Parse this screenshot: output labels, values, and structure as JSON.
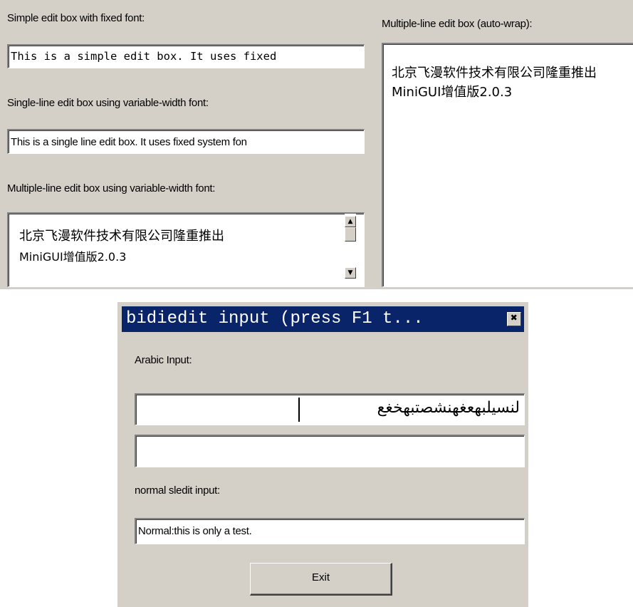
{
  "top_panel": {
    "simple_label": "Simple edit box with fixed font:",
    "simple_value": "This is a simple edit box. It uses fixed",
    "single_label": "Single-line edit box using variable-width font:",
    "single_value": "This is a single line edit box. It uses fixed system fon",
    "multi_label": "Multiple-line edit box using variable-width font:",
    "multi_value_line1": "北京飞漫软件技术有限公司隆重推出",
    "multi_value_line2": "MiniGUI增值版2.0.3",
    "autowrap_label": "Multiple-line edit box (auto-wrap):",
    "autowrap_value": "北京飞漫软件技术有限公司隆重推出MiniGUI增值版2.0.3"
  },
  "dialog": {
    "title": "bidiedit input (press F1 t...",
    "arabic_label": "Arabic Input:",
    "arabic_value": "لنسيلبهعغهنشصتبهخغع",
    "second_value": "",
    "normal_label": "normal sledit input:",
    "normal_value": "Normal:this is only a test.",
    "exit_label": "Exit"
  },
  "icons": {
    "close": "close-icon",
    "scroll_up": "arrow-up-icon",
    "scroll_down": "arrow-down-icon"
  }
}
